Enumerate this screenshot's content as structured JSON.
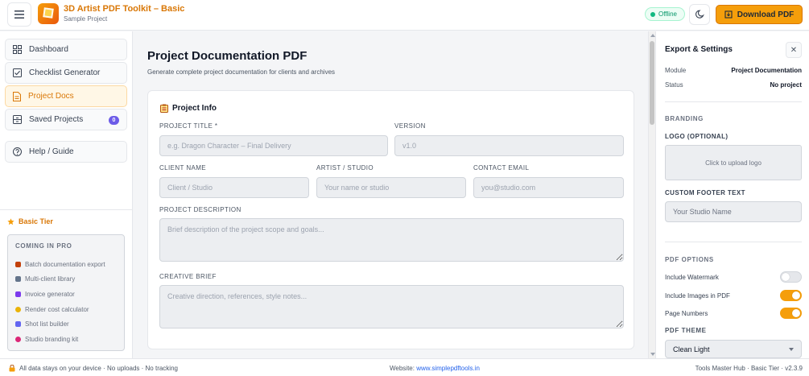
{
  "header": {
    "app_title": "3D Artist PDF Toolkit – Basic",
    "project_name": "Sample Project",
    "status_label": "Offline",
    "download_label": "Download PDF"
  },
  "sidebar": {
    "items": [
      {
        "label": "Dashboard",
        "icon": "grid-icon"
      },
      {
        "label": "Checklist Generator",
        "icon": "checkbox-icon"
      },
      {
        "label": "Project Docs",
        "icon": "document-icon",
        "active": true
      },
      {
        "label": "Saved Projects",
        "icon": "database-icon",
        "badge": "0"
      },
      {
        "label": "Help / Guide",
        "icon": "help-circle-icon"
      }
    ],
    "tier_label": "Basic Tier",
    "pro": {
      "title": "COMING IN PRO",
      "items": [
        {
          "label": "Batch documentation export",
          "color": "#c2410c"
        },
        {
          "label": "Multi-client library",
          "color": "#64748b"
        },
        {
          "label": "Invoice generator",
          "color": "#7c3aed"
        },
        {
          "label": "Render cost calculator",
          "color": "#eab308"
        },
        {
          "label": "Shot list builder",
          "color": "#6366f1"
        },
        {
          "label": "Studio branding kit",
          "color": "#db2777"
        }
      ]
    }
  },
  "main": {
    "title": "Project Documentation PDF",
    "subtitle": "Generate complete project documentation for clients and archives",
    "card_title": "Project Info",
    "fields": {
      "project_title": {
        "label": "PROJECT TITLE *",
        "placeholder": "e.g. Dragon Character – Final Delivery"
      },
      "version": {
        "label": "VERSION",
        "placeholder": "v1.0"
      },
      "client_name": {
        "label": "CLIENT NAME",
        "placeholder": "Client / Studio"
      },
      "artist": {
        "label": "ARTIST / STUDIO",
        "placeholder": "Your name or studio"
      },
      "contact_email": {
        "label": "CONTACT EMAIL",
        "placeholder": "you@studio.com"
      },
      "description": {
        "label": "PROJECT DESCRIPTION",
        "placeholder": "Brief description of the project scope and goals..."
      },
      "brief": {
        "label": "CREATIVE BRIEF",
        "placeholder": "Creative direction, references, style notes..."
      }
    }
  },
  "panel": {
    "title": "Export & Settings",
    "close_label": "✕",
    "module_key": "Module",
    "module_value": "Project Documentation",
    "status_key": "Status",
    "status_value": "No project",
    "branding_heading": "BRANDING",
    "logo_label": "LOGO (OPTIONAL)",
    "logo_upload": "Click to upload logo",
    "footer_label": "CUSTOM FOOTER TEXT",
    "footer_placeholder": "Your Studio Name",
    "options_heading": "PDF OPTIONS",
    "options": [
      {
        "label": "Include Watermark",
        "on": false
      },
      {
        "label": "Include Images in PDF",
        "on": true
      },
      {
        "label": "Page Numbers",
        "on": true
      }
    ],
    "theme_label": "PDF THEME",
    "theme_value": "Clean Light"
  },
  "footer": {
    "privacy": "All data stays on your device · No uploads · No tracking",
    "website_label": "Website:",
    "website_url": "www.simplepdftools.in",
    "version": "Tools Master Hub · Basic Tier · v2.3.9"
  },
  "colors": {
    "accent": "#f59e0b",
    "accent_dark": "#d97706",
    "badge": "#6d5ce8",
    "online": "#10b981"
  }
}
